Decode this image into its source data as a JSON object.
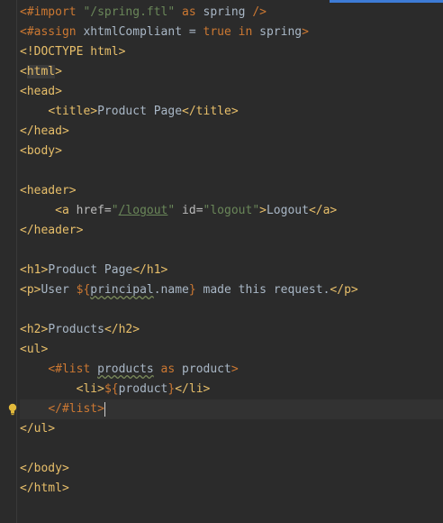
{
  "lines": [
    {
      "parts": [
        [
          "k",
          "<#import "
        ],
        [
          "s",
          "\"/spring.ftl\""
        ],
        [
          "k",
          " as "
        ],
        [
          "txt",
          "spring "
        ],
        [
          "k",
          "/>"
        ]
      ]
    },
    {
      "parts": [
        [
          "k",
          "<#assign "
        ],
        [
          "txt",
          "xhtmlCompliant = "
        ],
        [
          "k",
          "true in "
        ],
        [
          "txt",
          "spring"
        ],
        [
          "k",
          ">"
        ]
      ]
    },
    {
      "parts": [
        [
          "t",
          "<!DOCTYPE html>"
        ]
      ]
    },
    {
      "parts": [
        [
          "t",
          "<"
        ],
        [
          "t hl",
          "html"
        ],
        [
          "t",
          ">"
        ]
      ]
    },
    {
      "parts": [
        [
          "t",
          "<head>"
        ]
      ]
    },
    {
      "parts": [
        [
          "txt",
          "    "
        ],
        [
          "t",
          "<title>"
        ],
        [
          "txt",
          "Product Page"
        ],
        [
          "t",
          "</title>"
        ]
      ]
    },
    {
      "parts": [
        [
          "t",
          "</head>"
        ]
      ]
    },
    {
      "parts": [
        [
          "t",
          "<body>"
        ]
      ]
    },
    {
      "parts": [
        [
          "txt",
          ""
        ]
      ]
    },
    {
      "parts": [
        [
          "t",
          "<header>"
        ]
      ]
    },
    {
      "parts": [
        [
          "txt",
          "     "
        ],
        [
          "t",
          "<a "
        ],
        [
          "a",
          "href="
        ],
        [
          "s",
          "\""
        ],
        [
          "s ul",
          "/logout"
        ],
        [
          "s",
          "\" "
        ],
        [
          "a",
          "id="
        ],
        [
          "s",
          "\"logout\""
        ],
        [
          "t",
          ">"
        ],
        [
          "txt",
          "Logout"
        ],
        [
          "t",
          "</a>"
        ]
      ]
    },
    {
      "parts": [
        [
          "t",
          "</header>"
        ]
      ]
    },
    {
      "parts": [
        [
          "txt",
          ""
        ]
      ]
    },
    {
      "parts": [
        [
          "t",
          "<h1>"
        ],
        [
          "txt",
          "Product Page"
        ],
        [
          "t",
          "</h1>"
        ]
      ]
    },
    {
      "parts": [
        [
          "t",
          "<p>"
        ],
        [
          "txt",
          "User "
        ],
        [
          "k",
          "${"
        ],
        [
          "txt wavy",
          "principal"
        ],
        [
          "txt",
          ".name"
        ],
        [
          "k",
          "}"
        ],
        [
          "txt",
          " made this request."
        ],
        [
          "t",
          "</p>"
        ]
      ]
    },
    {
      "parts": [
        [
          "txt",
          ""
        ]
      ]
    },
    {
      "parts": [
        [
          "t",
          "<h2>"
        ],
        [
          "txt",
          "Products"
        ],
        [
          "t",
          "</h2>"
        ]
      ]
    },
    {
      "parts": [
        [
          "t",
          "<ul>"
        ]
      ]
    },
    {
      "parts": [
        [
          "txt",
          "    "
        ],
        [
          "k",
          "<#list "
        ],
        [
          "txt wavy",
          "products"
        ],
        [
          "k",
          " as "
        ],
        [
          "txt",
          "product"
        ],
        [
          "k",
          ">"
        ]
      ]
    },
    {
      "parts": [
        [
          "txt",
          "        "
        ],
        [
          "t",
          "<li>"
        ],
        [
          "k",
          "${"
        ],
        [
          "txt",
          "product"
        ],
        [
          "k",
          "}"
        ],
        [
          "t",
          "</li>"
        ]
      ]
    },
    {
      "parts": [
        [
          "txt",
          "    "
        ],
        [
          "k",
          "</#list>"
        ]
      ],
      "current": true,
      "caret": true,
      "bulb": true
    },
    {
      "parts": [
        [
          "t",
          "</ul>"
        ]
      ]
    },
    {
      "parts": [
        [
          "txt",
          ""
        ]
      ]
    },
    {
      "parts": [
        [
          "t",
          "</body>"
        ]
      ]
    },
    {
      "parts": [
        [
          "t",
          "</html>"
        ]
      ]
    }
  ],
  "icons": {
    "bulb": "lightbulb-icon"
  },
  "colors": {
    "tag": "#e8bf6a",
    "keyword": "#cc7832",
    "string": "#6a8759",
    "text": "#a9b7c6",
    "background": "#2b2b2b",
    "scroll_marker": "#3d7bd6"
  }
}
